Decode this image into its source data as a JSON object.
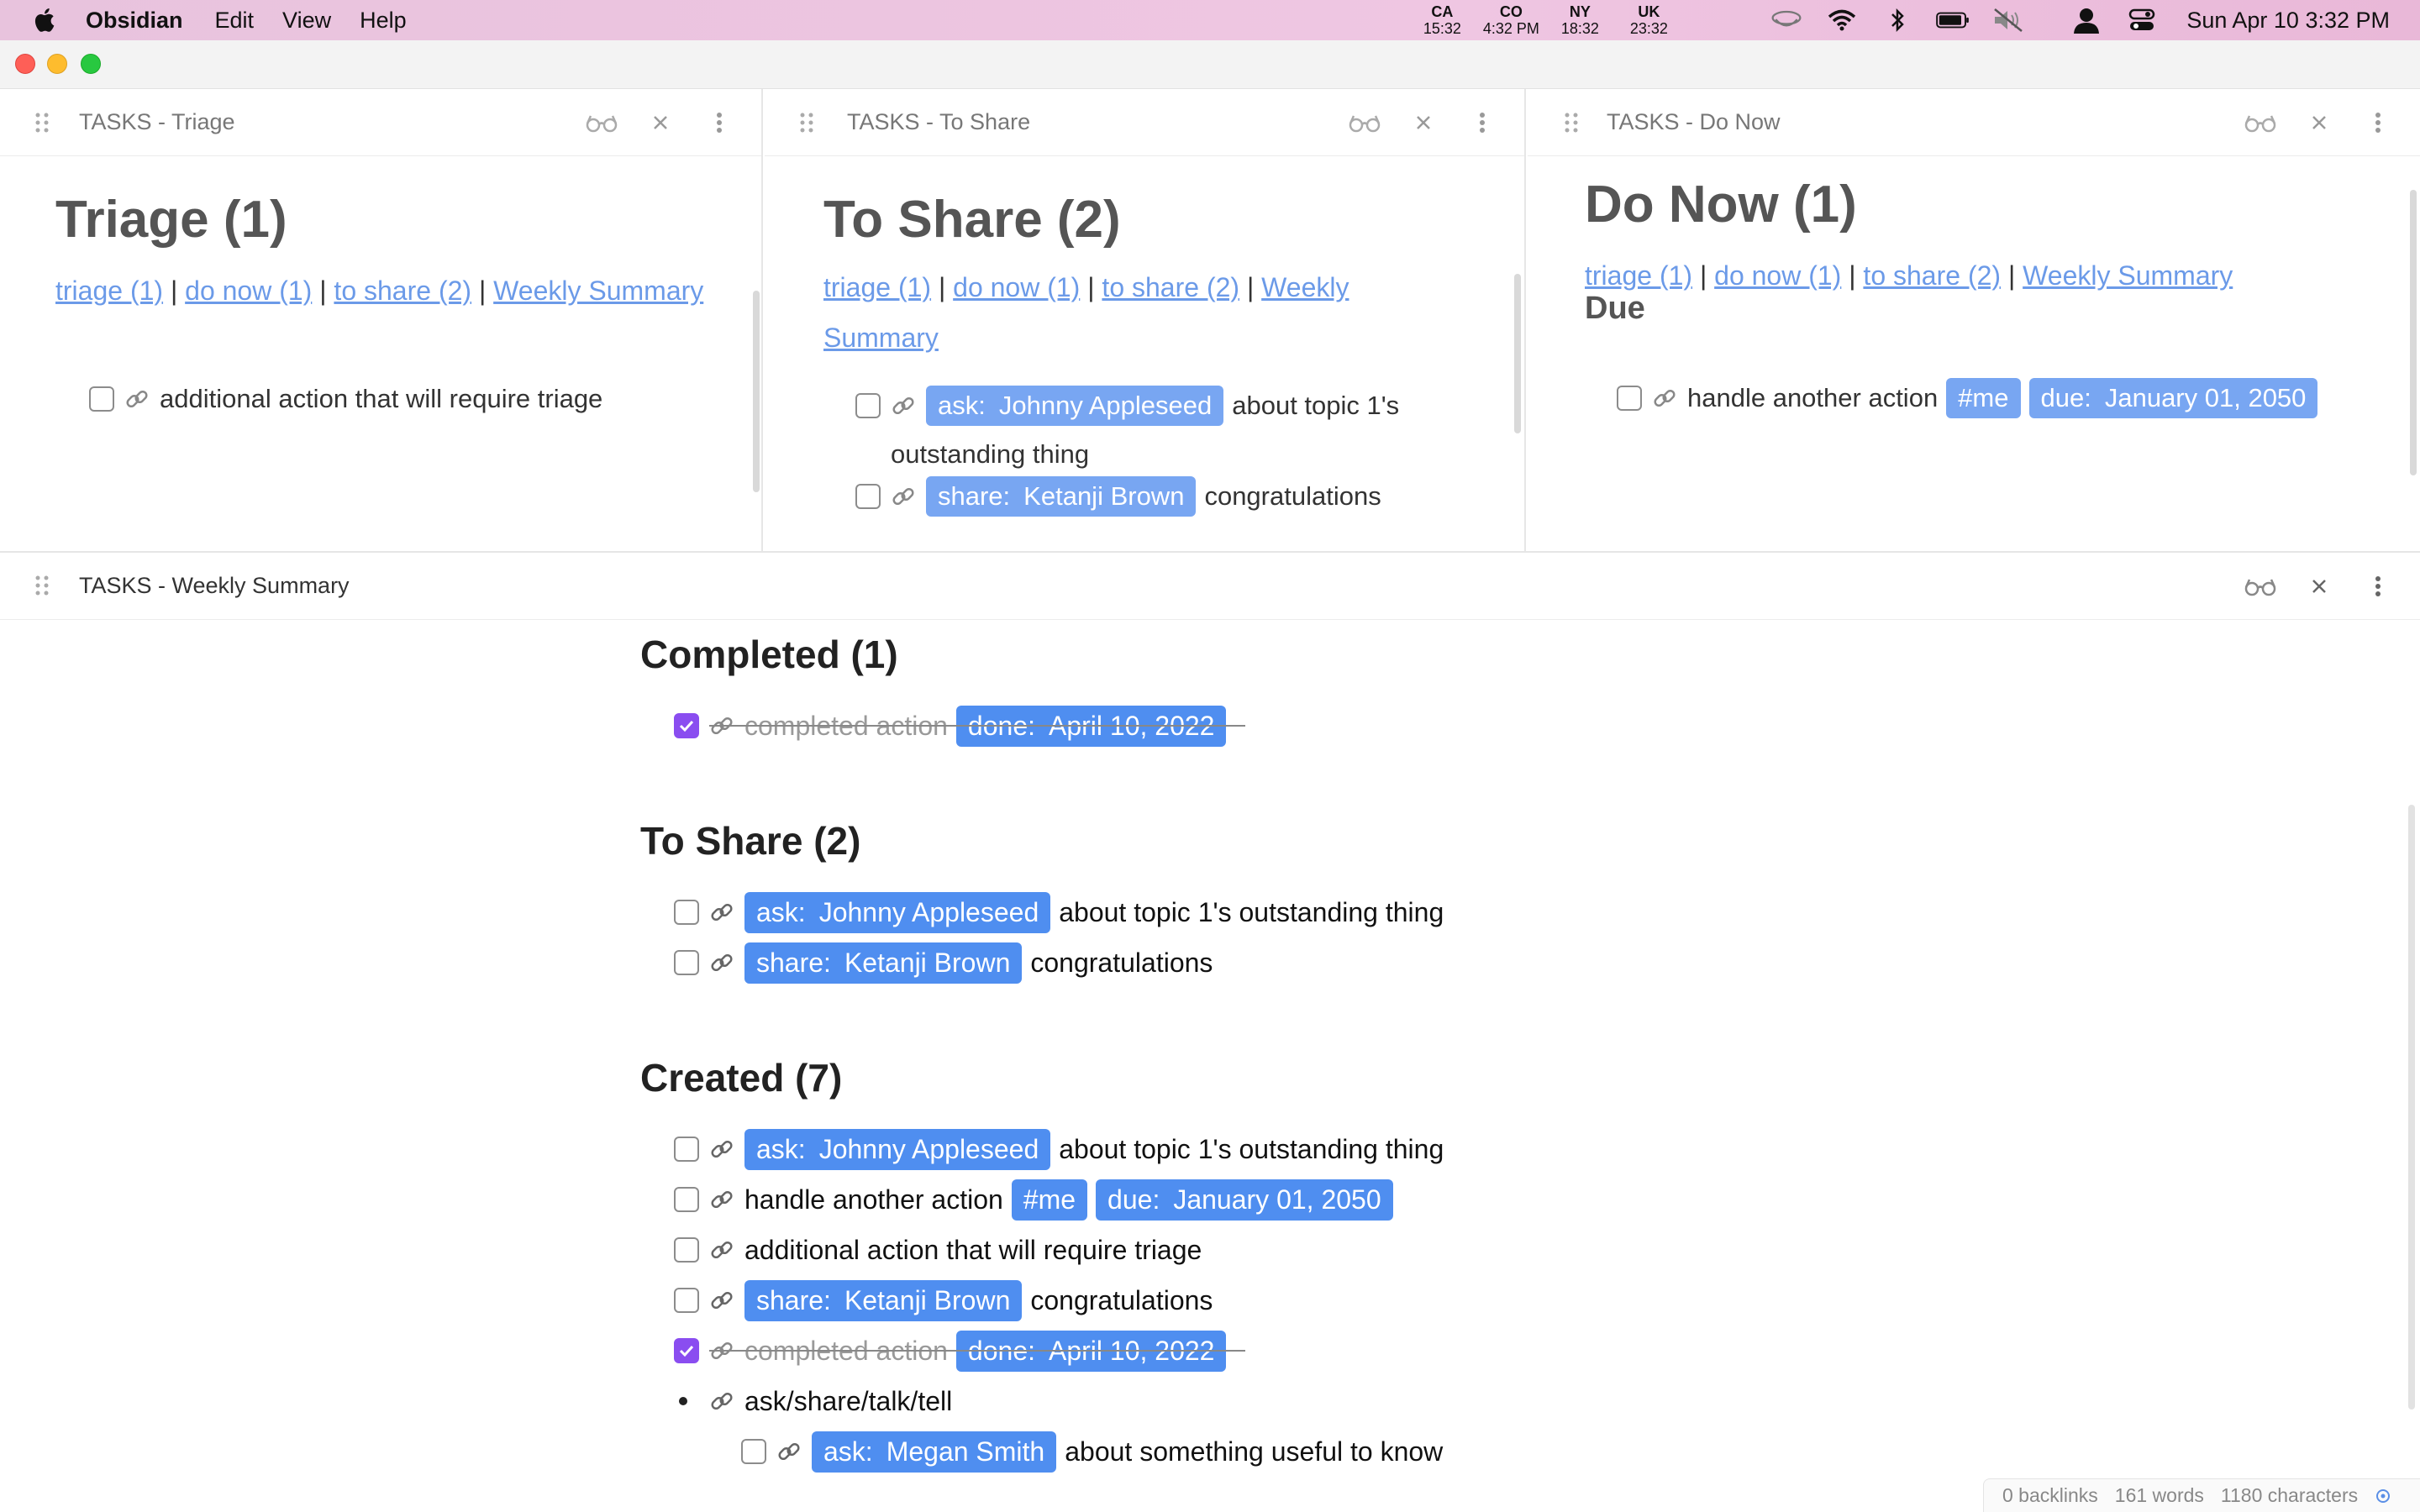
{
  "menubar": {
    "app_name": "Obsidian",
    "menus": [
      "Edit",
      "View",
      "Help"
    ],
    "clocks": [
      {
        "code": "CA",
        "time": "15:32"
      },
      {
        "code": "CO",
        "time": "4:32 PM"
      },
      {
        "code": "NY",
        "time": "18:32"
      },
      {
        "code": "UK",
        "time": "23:32"
      }
    ],
    "datetime": "Sun Apr 10  3:32 PM"
  },
  "panes": {
    "triage": {
      "header": "TASKS - Triage",
      "heading": "Triage (1)",
      "tasks": [
        {
          "text": "additional action that will require triage"
        }
      ]
    },
    "to_share": {
      "header": "TASKS - To Share",
      "heading": "To Share (2)",
      "link_weekly_part1": "Weekly",
      "link_weekly_part2": "Summary",
      "tasks": [
        {
          "tag_key": "ask:",
          "tag_value": "Johnny Appleseed",
          "text_part1": "about topic 1's",
          "text_part2": "outstanding thing"
        },
        {
          "tag_key": "share:",
          "tag_value": "Ketanji Brown",
          "text": "congratulations"
        }
      ]
    },
    "do_now": {
      "header": "TASKS - Do Now",
      "heading": "Do Now (1)",
      "subheading": "Due",
      "tasks": [
        {
          "text": "handle another action",
          "tag1": "#me",
          "due_key": "due:",
          "due_value": "January 01, 2050"
        }
      ]
    },
    "weekly": {
      "header": "TASKS - Weekly Summary"
    }
  },
  "nav_links": {
    "triage": "triage (1)",
    "do_now": "do now (1)",
    "to_share": "to share (2)",
    "weekly": "Weekly Summary",
    "separator": "|"
  },
  "weekly_summary": {
    "completed": {
      "heading": "Completed (1)",
      "tasks": [
        {
          "text": "completed action",
          "tag_key": "done:",
          "tag_value": "April 10, 2022",
          "checked": true
        }
      ]
    },
    "to_share": {
      "heading": "To Share (2)",
      "tasks": [
        {
          "tag_key": "ask:",
          "tag_value": "Johnny Appleseed",
          "text": "about topic 1's outstanding thing"
        },
        {
          "tag_key": "share:",
          "tag_value": "Ketanji Brown",
          "text": "congratulations"
        }
      ]
    },
    "created": {
      "heading": "Created (7)",
      "tasks": [
        {
          "tag_key": "ask:",
          "tag_value": "Johnny Appleseed",
          "text": "about topic 1's outstanding thing"
        },
        {
          "text": "handle another action",
          "tag1": "#me",
          "due_key": "due:",
          "due_value": "January 01, 2050"
        },
        {
          "text": "additional action that will require triage"
        },
        {
          "tag_key": "share:",
          "tag_value": "Ketanji Brown",
          "text": "congratulations"
        },
        {
          "text": "completed action",
          "tag_key": "done:",
          "tag_value": "April 10, 2022",
          "checked": true
        },
        {
          "text": "ask/share/talk/tell",
          "bullet": true
        },
        {
          "tag_key": "ask:",
          "tag_value": "Megan Smith",
          "text": "about something useful to know"
        }
      ]
    }
  },
  "statusbar": {
    "backlinks": "0 backlinks",
    "words": "161 words",
    "characters": "1180 characters"
  },
  "colors": {
    "tag": "#4f8ef0",
    "checked": "#8a4df0",
    "link": "#6b9ae8",
    "menubar": "#efc6e2"
  }
}
